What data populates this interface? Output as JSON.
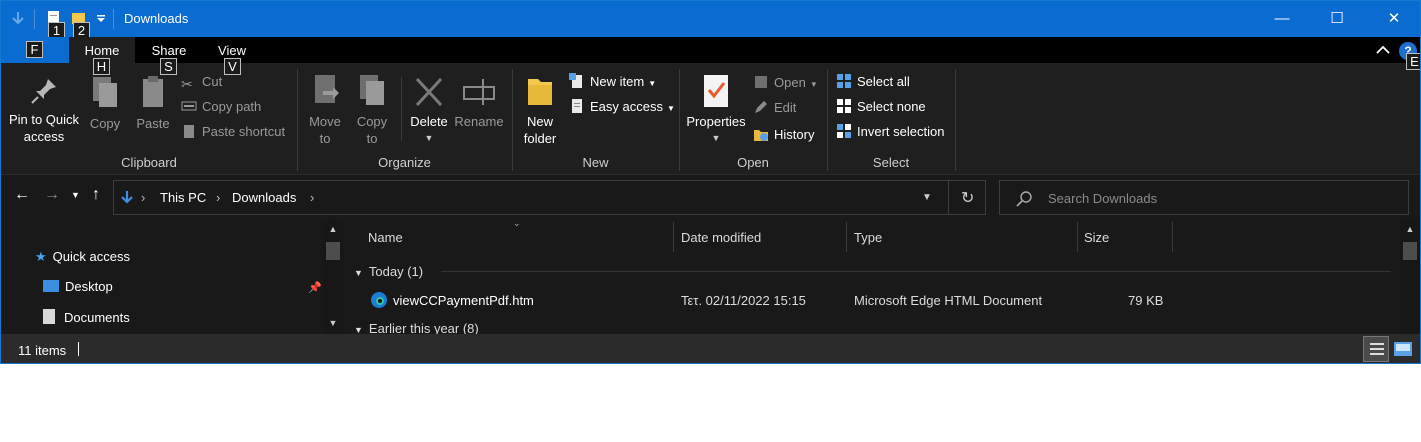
{
  "window": {
    "title": "Downloads",
    "quick_access_keys": [
      "1",
      "2"
    ],
    "minimize_glyph": "—",
    "maximize_glyph": "☐",
    "close_glyph": "✕"
  },
  "ribbon_tabs": [
    {
      "label": "File",
      "keytip": "F"
    },
    {
      "label": "Home",
      "keytip": "H"
    },
    {
      "label": "Share",
      "keytip": "S"
    },
    {
      "label": "View",
      "keytip": "V"
    }
  ],
  "ribbon_extra_keytip": "E",
  "ribbon": {
    "clipboard": {
      "label": "Clipboard",
      "pin_line1": "Pin to Quick",
      "pin_line2": "access",
      "copy": "Copy",
      "paste": "Paste",
      "cut": "Cut",
      "copy_path": "Copy path",
      "paste_shortcut": "Paste shortcut"
    },
    "organize": {
      "label": "Organize",
      "move_line1": "Move",
      "move_line2": "to",
      "copy_line1": "Copy",
      "copy_line2": "to",
      "delete": "Delete",
      "rename": "Rename"
    },
    "new": {
      "label": "New",
      "folder_line1": "New",
      "folder_line2": "folder",
      "new_item": "New item",
      "easy_access": "Easy access"
    },
    "open": {
      "label": "Open",
      "properties": "Properties",
      "open": "Open",
      "edit": "Edit",
      "history": "History"
    },
    "select": {
      "label": "Select",
      "select_all": "Select all",
      "select_none": "Select none",
      "invert": "Invert selection"
    }
  },
  "address": {
    "crumbs": [
      "This PC",
      "Downloads"
    ],
    "search_placeholder": "Search Downloads"
  },
  "nav_pane": {
    "items": [
      {
        "label": "Quick access",
        "icon": "star-icon"
      },
      {
        "label": "Desktop",
        "icon": "desktop-icon",
        "pinned": true
      },
      {
        "label": "Documents",
        "icon": "documents-icon"
      }
    ]
  },
  "columns": [
    "Name",
    "Date modified",
    "Type",
    "Size"
  ],
  "groups": [
    {
      "label": "Today (1)",
      "files": [
        {
          "name": "viewCCPaymentPdf.htm",
          "date": "Τετ. 02/11/2022 15:15",
          "type": "Microsoft Edge HTML Document",
          "size": "79 KB",
          "icon": "edge-icon"
        }
      ]
    },
    {
      "label": "Earlier this year (8)",
      "files": []
    }
  ],
  "status": {
    "item_count": "11 items"
  },
  "colors": {
    "accent": "#0a6bd0",
    "background": "#191919",
    "ribbon": "#1f1f1f",
    "tabbar": "#000000",
    "statusbar": "#2b2b2b"
  }
}
